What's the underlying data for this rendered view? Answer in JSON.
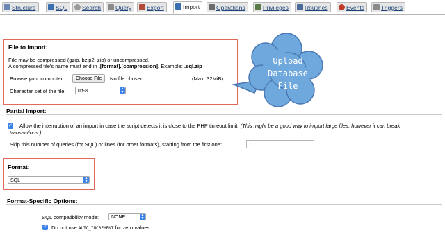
{
  "tabs": [
    {
      "label": "Structure",
      "icon": "structure-icon",
      "color": "#6a88b5"
    },
    {
      "label": "SQL",
      "icon": "sql-icon",
      "color": "#3a6fb0"
    },
    {
      "label": "Search",
      "icon": "search-icon",
      "color": "#7a7a7a"
    },
    {
      "label": "Query",
      "icon": "query-icon",
      "color": "#8a8a8a"
    },
    {
      "label": "Export",
      "icon": "export-icon",
      "color": "#b24a3a"
    },
    {
      "label": "Import",
      "icon": "import-icon",
      "color": "#3a6fb0"
    },
    {
      "label": "Operations",
      "icon": "operations-icon",
      "color": "#6b6b6b"
    },
    {
      "label": "Privileges",
      "icon": "privileges-icon",
      "color": "#5a7a4a"
    },
    {
      "label": "Routines",
      "icon": "routines-icon",
      "color": "#4a6a9a"
    },
    {
      "label": "Events",
      "icon": "events-icon",
      "color": "#c03a2a"
    },
    {
      "label": "Triggers",
      "icon": "triggers-icon",
      "color": "#7a7a7a"
    }
  ],
  "file_import": {
    "title": "File to import:",
    "line1": "File may be compressed (gzip, bzip2, zip) or uncompressed.",
    "line2_a": "A compressed file's name must end in ",
    "line2_b": ".[format].[compression]",
    "line2_c": ". Example: ",
    "line2_d": ".sql.zip",
    "browse_label": "Browse your computer:",
    "choose_button": "Choose File",
    "no_file": "No file chosen",
    "max_size": "(Max: 32MiB)",
    "charset_label": "Character set of the file:",
    "charset_value": "utf-8"
  },
  "callout": {
    "text_l1": "Upload",
    "text_l2": "Database",
    "text_l3": "File",
    "fill": "#6fa8dc"
  },
  "partial_import": {
    "title": "Partial Import:",
    "allow_text": "Allow the interruption of an import in case the script detects it is close to the PHP timeout limit.",
    "allow_note_l1": " (This might be a good way to import large files, however it can break",
    "allow_note_l2": "transactions.)",
    "skip_label": "Skip this number of queries (for SQL) or lines (for other formats), starting from the first one:",
    "skip_value": "0"
  },
  "format": {
    "title": "Format:",
    "value": "SQL"
  },
  "format_options": {
    "title": "Format-Specific Options:",
    "compat_label": "SQL compatibility mode:",
    "compat_value": "NONE",
    "auto_inc_a": "Do not use ",
    "auto_inc_code": "AUTO_INCREMENT",
    "auto_inc_b": " for zero values"
  },
  "colors": {
    "highlight_box": "#e06a5c",
    "accent_blue": "#3b82e8"
  }
}
